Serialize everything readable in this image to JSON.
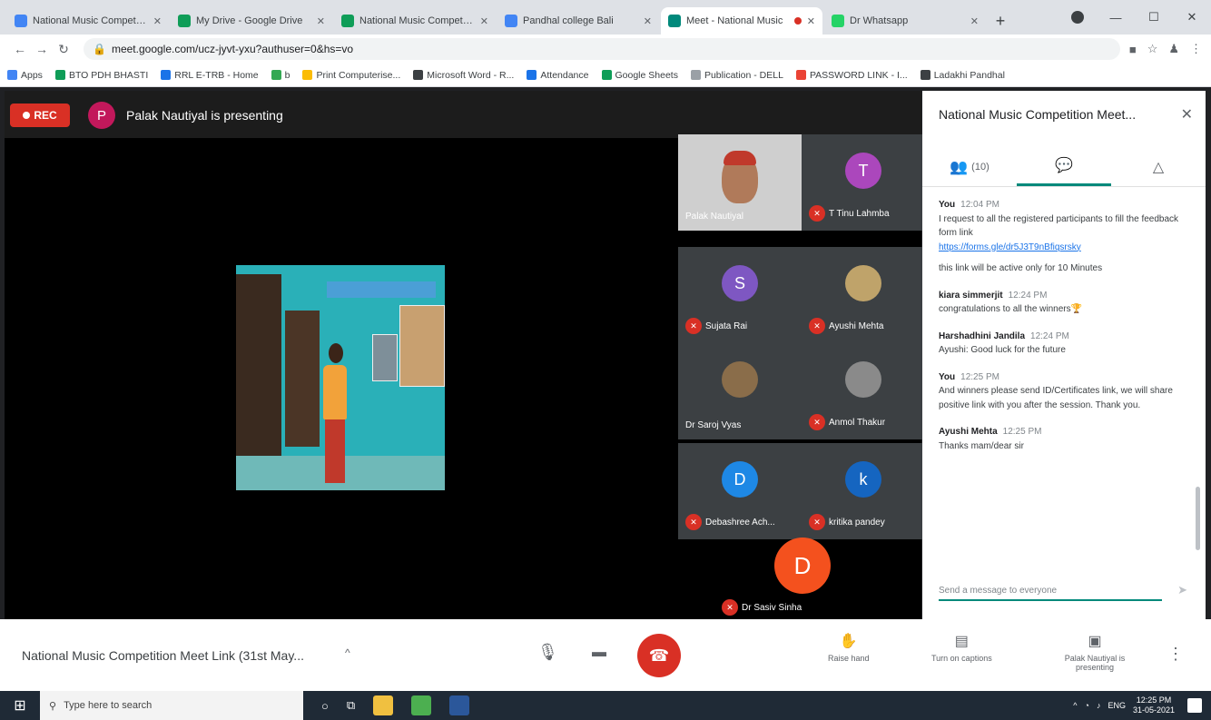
{
  "browser": {
    "tabs": [
      {
        "title": "National Music Competition",
        "favicon_color": "#4285f4",
        "active": false
      },
      {
        "title": "My Drive - Google Drive",
        "favicon_color": "#0f9d58",
        "active": false
      },
      {
        "title": "National Music Competition",
        "favicon_color": "#0f9d58",
        "active": false
      },
      {
        "title": "Pandhal college Bali",
        "favicon_color": "#4285f4",
        "active": false
      },
      {
        "title": "Meet - National Music",
        "favicon_color": "#00897b",
        "active": true
      },
      {
        "title": "Dr Whatsapp",
        "favicon_color": "#25d366",
        "active": false
      }
    ],
    "new_tab": "+",
    "window_controls": [
      "—",
      "☐",
      "✕"
    ],
    "url": "meet.google.com/ucz-jyvt-yxu?authuser=0&hs=vo",
    "bookmarks": [
      {
        "label": "Apps",
        "color": "#4285f4"
      },
      {
        "label": "BTO PDH BHASTI",
        "color": "#0f9d58"
      },
      {
        "label": "RRL E-TRB - Home",
        "color": "#1a73e8"
      },
      {
        "label": "b",
        "color": "#34a853"
      },
      {
        "label": "Print Computerise...",
        "color": "#fbbc05"
      },
      {
        "label": "Microsoft Word - R...",
        "color": "#3c4043"
      },
      {
        "label": "Attendance",
        "color": "#1a73e8"
      },
      {
        "label": "Google Sheets",
        "color": "#0f9d58"
      },
      {
        "label": "Publication - DELL",
        "color": "#9aa0a6"
      },
      {
        "label": "PASSWORD LINK - I...",
        "color": "#ea4335"
      },
      {
        "label": "Ladakhi Pandhal",
        "color": "#3c4043"
      }
    ]
  },
  "meet": {
    "rec_label": "REC",
    "presenter_initial": "P",
    "presenting_text": "Palak Nautiyal is presenting",
    "shared_banner": "",
    "participants": [
      {
        "name": "Palak Nautiyal",
        "type": "video"
      },
      {
        "name": "T Tinu Lahmba",
        "initial": "T",
        "color": "#ab47bc"
      },
      {
        "name": "Sujata Rai",
        "initial": "S",
        "color": "#7e57c2"
      },
      {
        "name": "Ayushi Mehta",
        "initial": "",
        "color": "#bfa36a"
      },
      {
        "name": "Dr Saroj Vyas",
        "initial": "",
        "color": "#8a6d4a"
      },
      {
        "name": "Anmol Thakur",
        "initial": "",
        "color": "#8a8a8a"
      },
      {
        "name": "Debashree Ach...",
        "initial": "D",
        "color": "#1e88e5"
      },
      {
        "name": "kritika pandey",
        "initial": "k",
        "color": "#1565c0"
      }
    ],
    "featured": {
      "name": "Dr Sasiv Sinha",
      "initial": "D"
    }
  },
  "panel": {
    "title": "National Music Competition Meet...",
    "tabs": [
      {
        "label": "(10)",
        "icon": "people-icon",
        "glyph": "👥"
      },
      {
        "label": "",
        "icon": "chat-icon",
        "glyph": "💬"
      },
      {
        "label": "",
        "icon": "activities-icon",
        "glyph": "△"
      }
    ],
    "messages": [
      {
        "sender": "You",
        "time": "12:04 PM",
        "text": "I request to all the registered participants to fill the feedback form link",
        "link": "https://forms.gle/dr5J3T9nBfiqsrsky",
        "extra": "this link will be active only for 10 Minutes"
      },
      {
        "sender": "kiara simmerjit",
        "time": "12:24 PM",
        "text": "congratulations to all the winners🏆",
        "link": "",
        "extra": ""
      },
      {
        "sender": "Harshadhini Jandila",
        "time": "12:24 PM",
        "text": "Ayushi: Good luck for the future",
        "link": "",
        "extra": ""
      },
      {
        "sender": "You",
        "time": "12:25 PM",
        "text": "And winners please send ID/Certificates link, we will share positive link with you after the session. Thank you.",
        "link": "",
        "extra": ""
      },
      {
        "sender": "Ayushi Mehta",
        "time": "12:25 PM",
        "text": "Thanks mam/dear sir",
        "link": "",
        "extra": ""
      }
    ],
    "input_placeholder": "Send a message to everyone"
  },
  "controls": {
    "meeting_name": "National Music Competition Meet Link (31st May...",
    "caret": "^",
    "raise_hand": "Raise hand",
    "captions": "Turn on captions",
    "presenting": "Palak Nautiyal is presenting"
  },
  "taskbar": {
    "search_placeholder": "Type here to search",
    "lang": "ENG",
    "time": "12:25 PM",
    "date": "31-05-2021"
  }
}
